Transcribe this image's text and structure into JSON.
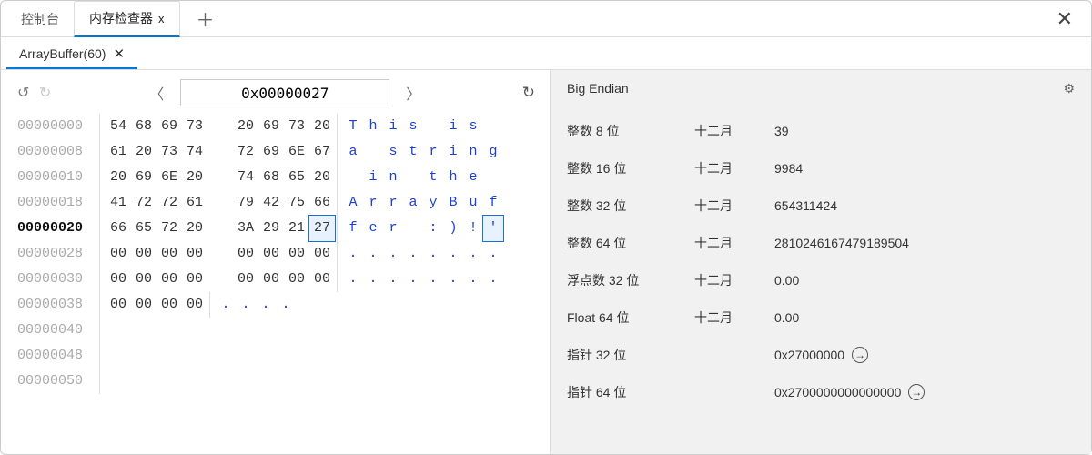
{
  "window": {
    "close_glyph": "✕"
  },
  "tabs": {
    "console": "控制台",
    "memory_inspector": "内存检查器",
    "add_glyph": "＋",
    "tab_close_glyph": "x"
  },
  "sub_tab": {
    "label": "ArrayBuffer(60)",
    "close_glyph": "✕"
  },
  "toolbar": {
    "undo_glyph": "↺",
    "redo_glyph": "↻",
    "prev_glyph": "〈",
    "next_glyph": "〉",
    "address": "0x00000027",
    "refresh_glyph": "↻"
  },
  "hex": {
    "current_addr_index": 4,
    "selected": {
      "row": 4,
      "byte_col": 7,
      "ascii_col": 7
    },
    "rows": [
      {
        "addr": "00000000",
        "bytes": [
          "54",
          "68",
          "69",
          "73",
          "20",
          "69",
          "73",
          "20"
        ],
        "ascii": [
          "T",
          "h",
          "i",
          "s",
          " ",
          "i",
          "s",
          " "
        ]
      },
      {
        "addr": "00000008",
        "bytes": [
          "61",
          "20",
          "73",
          "74",
          "72",
          "69",
          "6E",
          "67"
        ],
        "ascii": [
          "a",
          " ",
          "s",
          "t",
          "r",
          "i",
          "n",
          "g"
        ]
      },
      {
        "addr": "00000010",
        "bytes": [
          "20",
          "69",
          "6E",
          "20",
          "74",
          "68",
          "65",
          "20"
        ],
        "ascii": [
          " ",
          "i",
          "n",
          " ",
          "t",
          "h",
          "e",
          " "
        ]
      },
      {
        "addr": "00000018",
        "bytes": [
          "41",
          "72",
          "72",
          "61",
          "79",
          "42",
          "75",
          "66"
        ],
        "ascii": [
          "A",
          "r",
          "r",
          "a",
          "y",
          "B",
          "u",
          "f"
        ]
      },
      {
        "addr": "00000020",
        "bytes": [
          "66",
          "65",
          "72",
          "20",
          "3A",
          "29",
          "21",
          "27"
        ],
        "ascii": [
          "f",
          "e",
          "r",
          " ",
          ":",
          ")",
          "!",
          "'"
        ]
      },
      {
        "addr": "00000028",
        "bytes": [
          "00",
          "00",
          "00",
          "00",
          "00",
          "00",
          "00",
          "00"
        ],
        "ascii": [
          ".",
          ".",
          ".",
          ".",
          ".",
          ".",
          ".",
          "."
        ]
      },
      {
        "addr": "00000030",
        "bytes": [
          "00",
          "00",
          "00",
          "00",
          "00",
          "00",
          "00",
          "00"
        ],
        "ascii": [
          ".",
          ".",
          ".",
          ".",
          ".",
          ".",
          ".",
          "."
        ]
      },
      {
        "addr": "00000038",
        "bytes": [
          "00",
          "00",
          "00",
          "00"
        ],
        "ascii": [
          ".",
          ".",
          ".",
          "."
        ]
      },
      {
        "addr": "00000040",
        "bytes": [],
        "ascii": []
      },
      {
        "addr": "00000048",
        "bytes": [],
        "ascii": []
      },
      {
        "addr": "00000050",
        "bytes": [],
        "ascii": []
      }
    ]
  },
  "values_panel": {
    "header": "Big Endian",
    "gear_glyph": "⚙",
    "goto_glyph": "→",
    "month_label": "十二月",
    "rows": [
      {
        "name": "整数 8 位",
        "mid": "十二月",
        "val": "39"
      },
      {
        "name": "整数 16 位",
        "mid": "十二月",
        "val": "9984"
      },
      {
        "name": "整数 32 位",
        "mid": "十二月",
        "val": "654311424"
      },
      {
        "name": "整数 64 位",
        "mid": "十二月",
        "val": "2810246167479189504"
      },
      {
        "name": "浮点数 32 位",
        "mid": "十二月",
        "val": "0.00"
      },
      {
        "name": "Float 64 位",
        "mid": "十二月",
        "val": "0.00"
      },
      {
        "name": "指针 32 位",
        "mid": "",
        "val": "0x27000000",
        "goto": true
      },
      {
        "name": "指针 64 位",
        "mid": "",
        "val": "0x2700000000000000",
        "goto": true
      }
    ]
  }
}
